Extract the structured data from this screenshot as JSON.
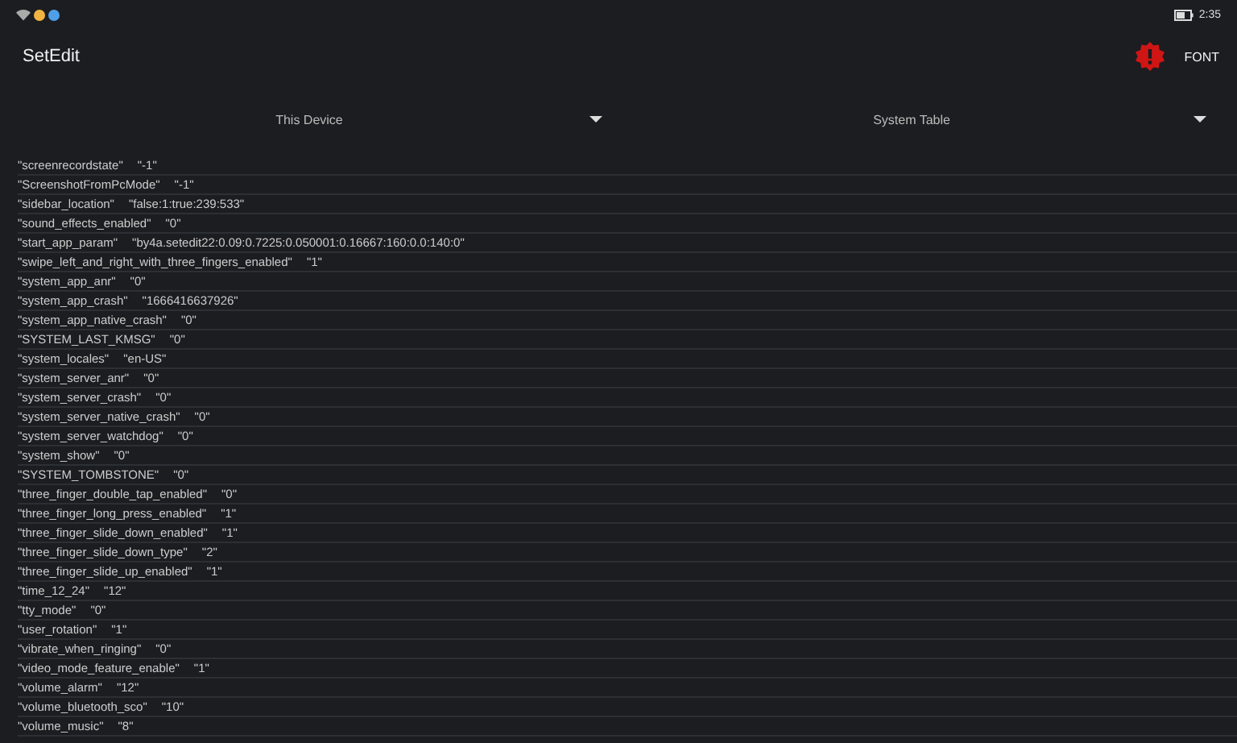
{
  "status_bar": {
    "time": "2:35"
  },
  "app_bar": {
    "title": "SetEdit",
    "action": "FONT"
  },
  "spinners": [
    {
      "label": "This Device"
    },
    {
      "label": "System Table"
    }
  ],
  "settings": [
    {
      "key": "\"screenrecordstate\"",
      "value": "\"-1\""
    },
    {
      "key": "\"ScreenshotFromPcMode\"",
      "value": "\"-1\""
    },
    {
      "key": "\"sidebar_location\"",
      "value": "\"false:1:true:239:533\""
    },
    {
      "key": "\"sound_effects_enabled\"",
      "value": "\"0\""
    },
    {
      "key": "\"start_app_param\"",
      "value": "\"by4a.setedit22:0.09:0.7225:0.050001:0.16667:160:0.0:140:0\""
    },
    {
      "key": "\"swipe_left_and_right_with_three_fingers_enabled\"",
      "value": "\"1\""
    },
    {
      "key": "\"system_app_anr\"",
      "value": "\"0\""
    },
    {
      "key": "\"system_app_crash\"",
      "value": "\"1666416637926\""
    },
    {
      "key": "\"system_app_native_crash\"",
      "value": "\"0\""
    },
    {
      "key": "\"SYSTEM_LAST_KMSG\"",
      "value": "\"0\""
    },
    {
      "key": "\"system_locales\"",
      "value": "\"en-US\""
    },
    {
      "key": "\"system_server_anr\"",
      "value": "\"0\""
    },
    {
      "key": "\"system_server_crash\"",
      "value": "\"0\""
    },
    {
      "key": "\"system_server_native_crash\"",
      "value": "\"0\""
    },
    {
      "key": "\"system_server_watchdog\"",
      "value": "\"0\""
    },
    {
      "key": "\"system_show\"",
      "value": "\"0\""
    },
    {
      "key": "\"SYSTEM_TOMBSTONE\"",
      "value": "\"0\""
    },
    {
      "key": "\"three_finger_double_tap_enabled\"",
      "value": "\"0\""
    },
    {
      "key": "\"three_finger_long_press_enabled\"",
      "value": "\"1\""
    },
    {
      "key": "\"three_finger_slide_down_enabled\"",
      "value": "\"1\""
    },
    {
      "key": "\"three_finger_slide_down_type\"",
      "value": "\"2\""
    },
    {
      "key": "\"three_finger_slide_up_enabled\"",
      "value": "\"1\""
    },
    {
      "key": "\"time_12_24\"",
      "value": "\"12\""
    },
    {
      "key": "\"tty_mode\"",
      "value": "\"0\""
    },
    {
      "key": "\"user_rotation\"",
      "value": "\"1\""
    },
    {
      "key": "\"vibrate_when_ringing\"",
      "value": "\"0\""
    },
    {
      "key": "\"video_mode_feature_enable\"",
      "value": "\"1\""
    },
    {
      "key": "\"volume_alarm\"",
      "value": "\"12\""
    },
    {
      "key": "\"volume_bluetooth_sco\"",
      "value": "\"10\""
    },
    {
      "key": "\"volume_music\"",
      "value": "\"8\""
    }
  ]
}
